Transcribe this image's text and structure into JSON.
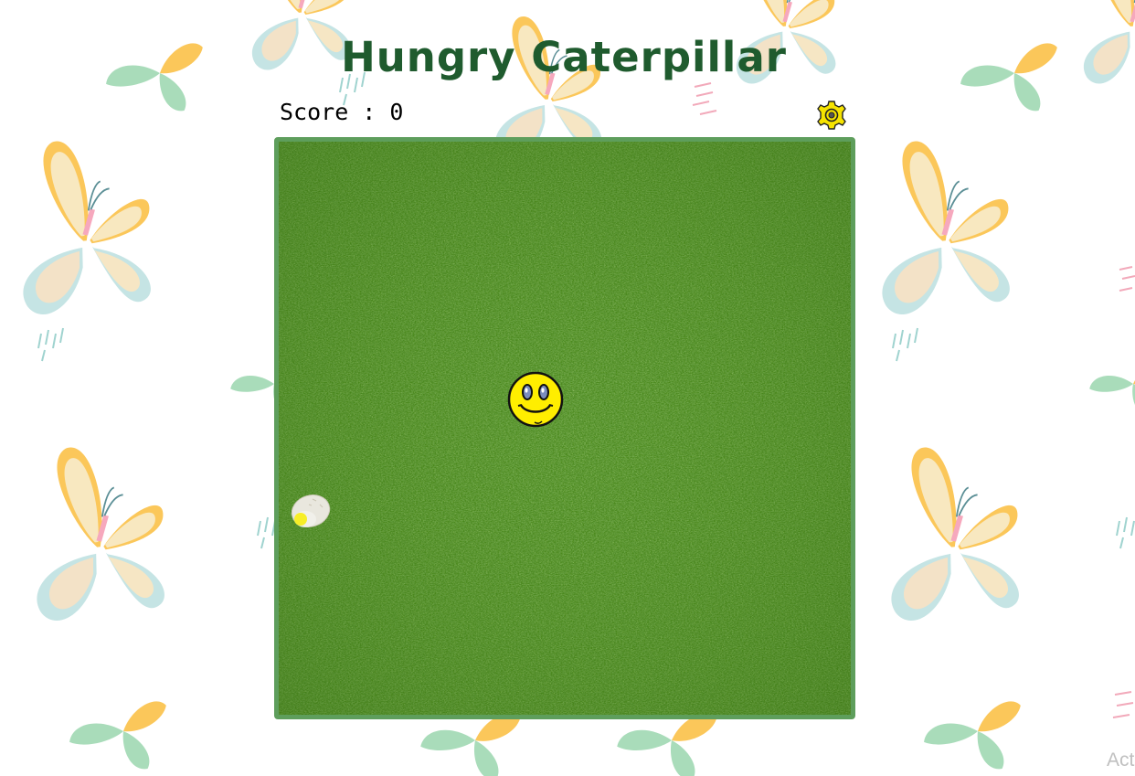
{
  "game": {
    "title": "Hungry Caterpillar",
    "score_label": "Score : ",
    "score_value": "0",
    "board": {
      "player_icon": "smiley-face-icon",
      "food_icon": "egg-icon"
    },
    "settings_icon": "gear-icon"
  },
  "corner_text": "Act",
  "colors": {
    "title": "#1f5b2e",
    "board_border": "#5e9e5c",
    "grass": "#4c8a1e",
    "player": "#ffee00",
    "settings_icon": "#f6e300",
    "butterfly_wing_outer": "#fbc75a",
    "butterfly_wing_inner": "#f8e8c0",
    "butterfly_wing_lower": "#bfe1e1",
    "butterfly_leaf": "#a9dcba"
  }
}
